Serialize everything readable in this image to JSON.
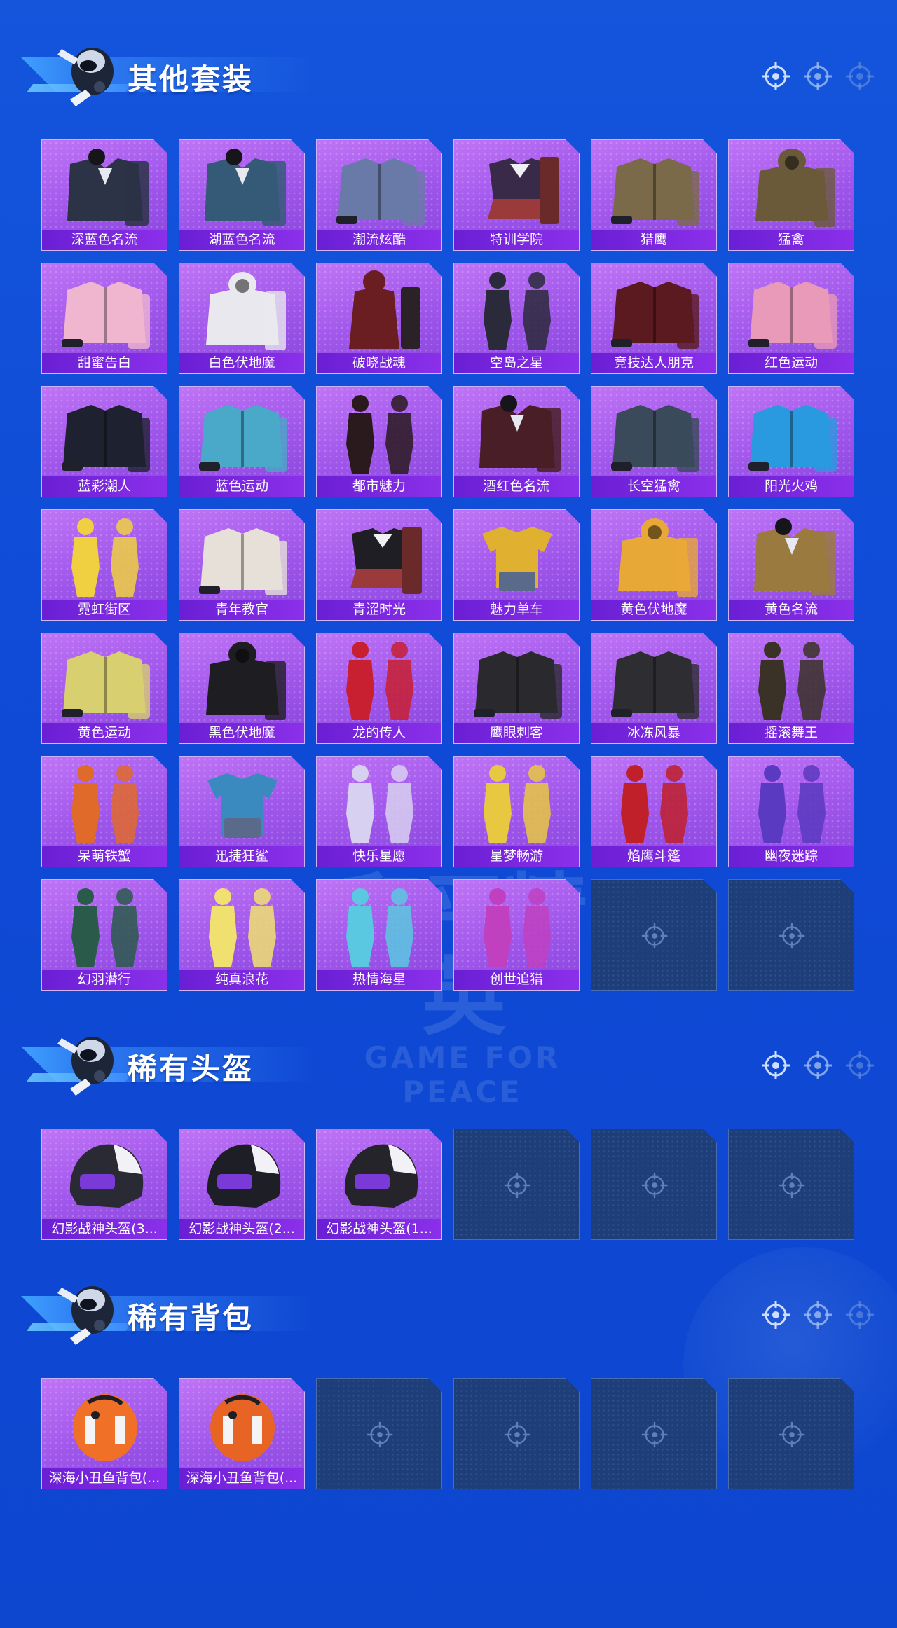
{
  "colors": {
    "background": "#1455dc",
    "card_purple": "#a85cf0",
    "label_purple": "#7a28e0",
    "empty_slot": "#1d3e78"
  },
  "watermark": {
    "line1": "和平精英",
    "line2": "GAME FOR PEACE"
  },
  "sections": [
    {
      "id": "outfits",
      "title": "其他套装",
      "items": [
        {
          "name": "深蓝色名流",
          "icon": "suit-icon",
          "tint": "#2c3346"
        },
        {
          "name": "湖蓝色名流",
          "icon": "suit-icon",
          "tint": "#355a78"
        },
        {
          "name": "潮流炫酷",
          "icon": "jacket-icon",
          "tint": "#6a7aa8"
        },
        {
          "name": "特训学院",
          "icon": "uniform-icon",
          "tint": "#3a2a4a"
        },
        {
          "name": "猎鹰",
          "icon": "jacket-icon",
          "tint": "#7a6a4a"
        },
        {
          "name": "猛禽",
          "icon": "hoodie-icon",
          "tint": "#6b5a3a"
        },
        {
          "name": "甜蜜告白",
          "icon": "jacket-icon",
          "tint": "#f0b6d0"
        },
        {
          "name": "白色伏地魔",
          "icon": "hoodie-icon",
          "tint": "#e8e8ee"
        },
        {
          "name": "破晓战魂",
          "icon": "coat-icon",
          "tint": "#6a1e22"
        },
        {
          "name": "空岛之星",
          "icon": "figure-icon",
          "tint": "#2a2a3a"
        },
        {
          "name": "竞技达人朋克",
          "icon": "jacket-icon",
          "tint": "#5a1a20"
        },
        {
          "name": "红色运动",
          "icon": "jacket-icon",
          "tint": "#e89ab8"
        },
        {
          "name": "蓝彩潮人",
          "icon": "jacket-icon",
          "tint": "#1e2230"
        },
        {
          "name": "蓝色运动",
          "icon": "jacket-icon",
          "tint": "#4aa8c8"
        },
        {
          "name": "都市魅力",
          "icon": "figure-icon",
          "tint": "#2a1a1e"
        },
        {
          "name": "酒红色名流",
          "icon": "suit-icon",
          "tint": "#4a1e26"
        },
        {
          "name": "长空猛禽",
          "icon": "jacket-icon",
          "tint": "#3a4a5a"
        },
        {
          "name": "阳光火鸡",
          "icon": "jacket-icon",
          "tint": "#2a9ae0"
        },
        {
          "name": "霓虹街区",
          "icon": "figure-icon",
          "tint": "#f0d040"
        },
        {
          "name": "青年教官",
          "icon": "jacket-icon",
          "tint": "#e6e0d8"
        },
        {
          "name": "青涩时光",
          "icon": "uniform-icon",
          "tint": "#1e1e24"
        },
        {
          "name": "魅力单车",
          "icon": "shirt-icon",
          "tint": "#e0b030"
        },
        {
          "name": "黄色伏地魔",
          "icon": "hoodie-icon",
          "tint": "#e8a838"
        },
        {
          "name": "黄色名流",
          "icon": "suit-icon",
          "tint": "#9a7a3e"
        },
        {
          "name": "黄色运动",
          "icon": "jacket-icon",
          "tint": "#d8d070"
        },
        {
          "name": "黑色伏地魔",
          "icon": "hoodie-icon",
          "tint": "#1e1e22"
        },
        {
          "name": "龙的传人",
          "icon": "figure-icon",
          "tint": "#c82030"
        },
        {
          "name": "鹰眼刺客",
          "icon": "jacket-icon",
          "tint": "#2a2a2e"
        },
        {
          "name": "冰冻风暴",
          "icon": "jacket-icon",
          "tint": "#2e2e32"
        },
        {
          "name": "摇滚舞王",
          "icon": "figure-icon",
          "tint": "#3a3226"
        },
        {
          "name": "呆萌铁蟹",
          "icon": "figure-icon",
          "tint": "#e06a2a"
        },
        {
          "name": "迅捷狂鲨",
          "icon": "shirt-icon",
          "tint": "#3a8ac0"
        },
        {
          "name": "快乐星愿",
          "icon": "figure-icon",
          "tint": "#d8d0f0"
        },
        {
          "name": "星梦畅游",
          "icon": "figure-icon",
          "tint": "#e8c840"
        },
        {
          "name": "焰鹰斗篷",
          "icon": "figure-icon",
          "tint": "#c0202a"
        },
        {
          "name": "幽夜迷踪",
          "icon": "figure-icon",
          "tint": "#5a3ac0"
        },
        {
          "name": "幻羽潜行",
          "icon": "figure-icon",
          "tint": "#2a5a4a"
        },
        {
          "name": "纯真浪花",
          "icon": "figure-icon",
          "tint": "#f0e070"
        },
        {
          "name": "热情海星",
          "icon": "figure-icon",
          "tint": "#5ac8e0"
        },
        {
          "name": "创世追猎",
          "icon": "figure-icon",
          "tint": "#c040c0"
        }
      ],
      "empty_slots": 2
    },
    {
      "id": "helmets",
      "title": "稀有头盔",
      "items": [
        {
          "name": "幻影战神头盔(3...",
          "icon": "helmet-icon",
          "tint": "#2a2a34"
        },
        {
          "name": "幻影战神头盔(2...",
          "icon": "helmet-icon",
          "tint": "#1e1e26"
        },
        {
          "name": "幻影战神头盔(1...",
          "icon": "helmet-icon",
          "tint": "#24242a"
        }
      ],
      "empty_slots": 3
    },
    {
      "id": "backpacks",
      "title": "稀有背包",
      "items": [
        {
          "name": "深海小丑鱼背包(...",
          "icon": "backpack-icon",
          "tint": "#f07028"
        },
        {
          "name": "深海小丑鱼背包(...",
          "icon": "backpack-icon",
          "tint": "#e86424"
        }
      ],
      "empty_slots": 4
    }
  ]
}
